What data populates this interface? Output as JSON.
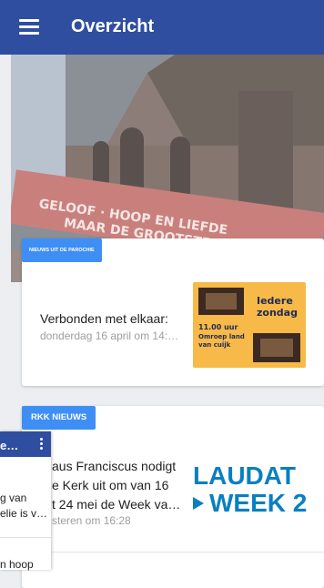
{
  "appbar": {
    "title": "Overzicht",
    "color": "#2f4ea0"
  },
  "hero": {
    "banner_line1": "GELOOF · HOOP EN LIEFDE",
    "banner_line2": "MAAR DE GROOTSTE ..."
  },
  "card1": {
    "badge": "NIEUWS UIT DE PAROCHIE",
    "title": "Verbonden met elkaar:",
    "date": "donderdag 16 april om 14:…",
    "poster": {
      "line1": "Iedere",
      "line2": "zondag",
      "line3": "11.00 uur",
      "line4": "Omroep land",
      "line5": "van cuijk"
    }
  },
  "card2": {
    "badge": "RKK NIEUWS",
    "lines": [
      "aus Franciscus nodigt",
      "e Kerk uit om van 16",
      "t 24 mei de Week va…"
    ],
    "time": "steren om 16:28",
    "logo_line1": "LAUDAT",
    "logo_line2": "WEEK 2"
  },
  "overlay": {
    "title": "e…",
    "line1": "g van",
    "line2": "elie is v…",
    "bottom": "n hoop"
  },
  "accent": "#3f8ef5"
}
